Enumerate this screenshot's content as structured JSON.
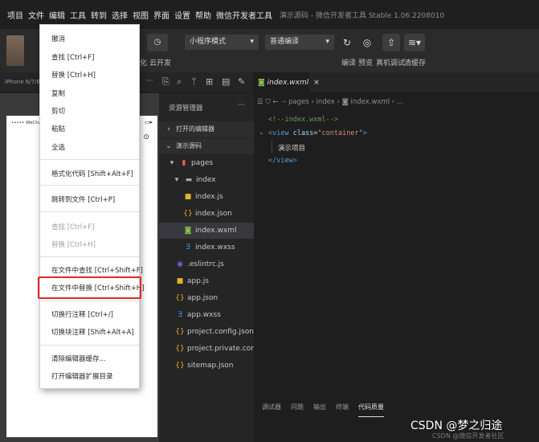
{
  "menubar": {
    "items": [
      "项目",
      "文件",
      "编辑",
      "工具",
      "转到",
      "选择",
      "视图",
      "界面",
      "设置",
      "帮助",
      "微信开发者工具"
    ],
    "title": "演示源码 - 微信开发者工具 Stable 1.06.2208010"
  },
  "toolbar": {
    "mode_select": "小程序模式",
    "compile_select": "普通编译",
    "labels": {
      "cloud": "云开发",
      "compile": "编译",
      "preview": "预览",
      "remote_debug": "真机调试",
      "clear_cache": "清缓存"
    },
    "partial_char": "化"
  },
  "subbar": {
    "device": "iPhone 6/7/8",
    "tab_label": "index.wxml",
    "tab_close": "×"
  },
  "simulator": {
    "status_left": "••••• WeChat",
    "battery": "▭▸"
  },
  "explorer": {
    "title": "资源管理器",
    "more": "···",
    "rows": [
      {
        "label": "打开的编辑器",
        "kind": "section",
        "icon": "›"
      },
      {
        "label": "演示源码",
        "kind": "section",
        "icon": "⌄"
      },
      {
        "label": "pages",
        "kind": "folder-open",
        "icon": "▮"
      },
      {
        "label": "index",
        "kind": "folder-open",
        "icon": "▬"
      },
      {
        "label": "index.js",
        "kind": "js",
        "icon": "■"
      },
      {
        "label": "index.json",
        "kind": "json",
        "icon": "{}"
      },
      {
        "label": "index.wxml",
        "kind": "wxml",
        "icon": "◙",
        "selected": true
      },
      {
        "label": "index.wxss",
        "kind": "wxss",
        "icon": "∃"
      },
      {
        "label": ".eslintrc.js",
        "kind": "eslint",
        "icon": "◉"
      },
      {
        "label": "app.js",
        "kind": "js",
        "icon": "■"
      },
      {
        "label": "app.json",
        "kind": "json",
        "icon": "{}"
      },
      {
        "label": "app.wxss",
        "kind": "wxss",
        "icon": "∃"
      },
      {
        "label": "project.config.json",
        "kind": "json",
        "icon": "{}"
      },
      {
        "label": "project.private.config.js...",
        "kind": "json",
        "icon": "{}"
      },
      {
        "label": "sitemap.json",
        "kind": "json",
        "icon": "{}"
      }
    ]
  },
  "editor": {
    "breadcrumb": "pages › index › ◙ index.wxml › ...",
    "code": {
      "comment": "<!--index.wxml-->",
      "open_tag": "<view",
      "attr": "class",
      "value": "\"container\"",
      "close_bracket": ">",
      "text": "演示项目",
      "end_tag": "</view>"
    },
    "bottom_tabs": [
      "调试器",
      "问题",
      "输出",
      "终端",
      "代码质量"
    ]
  },
  "edit_menu": {
    "items": [
      {
        "label": "撤消",
        "disabled": false
      },
      {
        "label": "查找  [Ctrl+F]",
        "disabled": false
      },
      {
        "label": "替换  [Ctrl+H]",
        "disabled": false
      },
      {
        "label": "复制",
        "disabled": false
      },
      {
        "label": "剪切",
        "disabled": false
      },
      {
        "label": "粘贴",
        "disabled": false
      },
      {
        "label": "全选",
        "disabled": false
      },
      {
        "label": "格式化代码  [Shift+Alt+F]",
        "disabled": false
      },
      {
        "label": "跳转到文件  [Ctrl+P]",
        "disabled": false
      },
      {
        "label": "查找  [Ctrl+F]",
        "disabled": true
      },
      {
        "label": "替换  [Ctrl+H]",
        "disabled": true
      },
      {
        "label": "在文件中查找  [Ctrl+Shift+F]",
        "disabled": false
      },
      {
        "label": "在文件中替换  [Ctrl+Shift+H]",
        "disabled": false,
        "highlighted": true
      },
      {
        "label": "切换行注释  [Ctrl+/]",
        "disabled": false
      },
      {
        "label": "切换块注释  [Shift+Alt+A]",
        "disabled": false
      },
      {
        "label": "清除编辑器缓存...",
        "disabled": false
      },
      {
        "label": "打开编辑器扩展目录",
        "disabled": false
      }
    ],
    "highlight_color": "#e02828"
  },
  "watermark": {
    "text": "CSDN @梦之归途",
    "faint": "CSDN @微信开发者社区"
  }
}
